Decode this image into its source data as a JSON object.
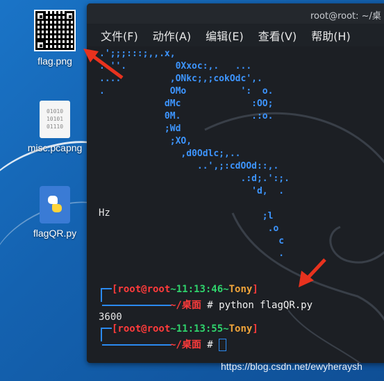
{
  "desktop": {
    "icons": [
      {
        "label": "flag.png",
        "icon": "qr-code-image-icon"
      },
      {
        "label": "misc.pcapng",
        "icon": "binary-file-icon"
      },
      {
        "label": "flagQR.py",
        "icon": "python-file-icon"
      }
    ],
    "binary_glyph_lines": [
      "01010",
      "10101",
      "01110"
    ]
  },
  "terminal": {
    "title": "root@root: ~/桌",
    "menu": [
      "文件(F)",
      "动作(A)",
      "编辑(E)",
      "查看(V)",
      "帮助(H)"
    ],
    "ascii_art": ".';;;:::;,,.x,\n..''.         0Xxoc:,.   ...\n....         ,ONkc;,;cokOdc',.\n.            OMo          ':  o.\n            dMc             :OO;\n            0M.             .:o.\n            ;Wd\n             ;XO,\n               ,d0Odlc;,..\n                  ..',;:cdOOd::,.\n                          .:d;.':;.\n                            'd,  .\n\n                              ;l\n                               .o\n                                 c\n                                 .",
    "output_hz": "Hz",
    "prompt1": {
      "user": "[root@root",
      "time": "11:13:46",
      "name": "Tony",
      "path": "~/桌面",
      "symbol": "#",
      "command": "python flagQR.py"
    },
    "output_number": "3600",
    "prompt2": {
      "user": "[root@root",
      "time": "11:13:55",
      "name": "Tony",
      "path": "~/桌面",
      "symbol": "#",
      "command": ""
    }
  },
  "watermark": "https://blog.csdn.net/ewyheraysh",
  "colors": {
    "desktop": "#1462b0",
    "terminal_bg": "#1c1f24",
    "prompt_red": "#ff3b3b",
    "prompt_green": "#2fd36c",
    "prompt_yellow": "#f0a43a",
    "art_blue": "#3d95ff",
    "annotation_arrow": "#e8321e"
  }
}
